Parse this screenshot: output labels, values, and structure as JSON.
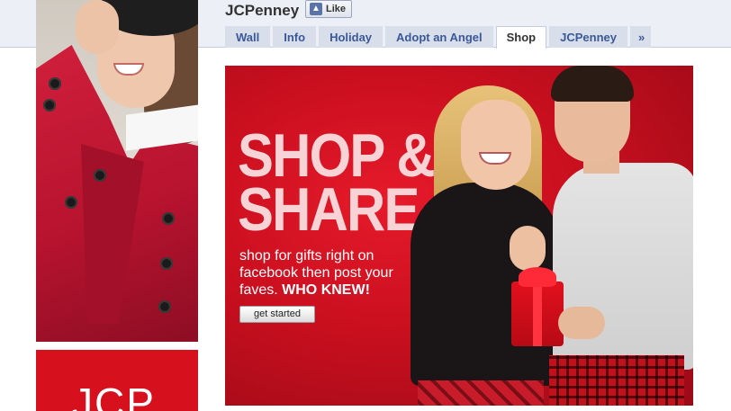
{
  "page": {
    "name": "JCPenney",
    "like_label": "Like",
    "like_icon": "thumbs-up-icon"
  },
  "tabs": [
    {
      "label": "Wall",
      "active": false
    },
    {
      "label": "Info",
      "active": false
    },
    {
      "label": "Holiday",
      "active": false
    },
    {
      "label": "Adopt an Angel",
      "active": false
    },
    {
      "label": "Shop",
      "active": true
    },
    {
      "label": "JCPenney",
      "active": false
    },
    {
      "label": "»",
      "active": false
    }
  ],
  "profile": {
    "logo_text": "JCP"
  },
  "banner": {
    "headline_line1": "SHOP &",
    "headline_line2": "SHARE",
    "tagline": "shop for gifts right on facebook then post your faves.",
    "tagline_emphasis": "WHO KNEW!",
    "cta_label": "get started"
  },
  "colors": {
    "facebook_blue": "#3b5998",
    "tab_bg": "#d8dfea",
    "banner_red": "#c90f1f",
    "headline_pink": "#f7d3d6"
  }
}
